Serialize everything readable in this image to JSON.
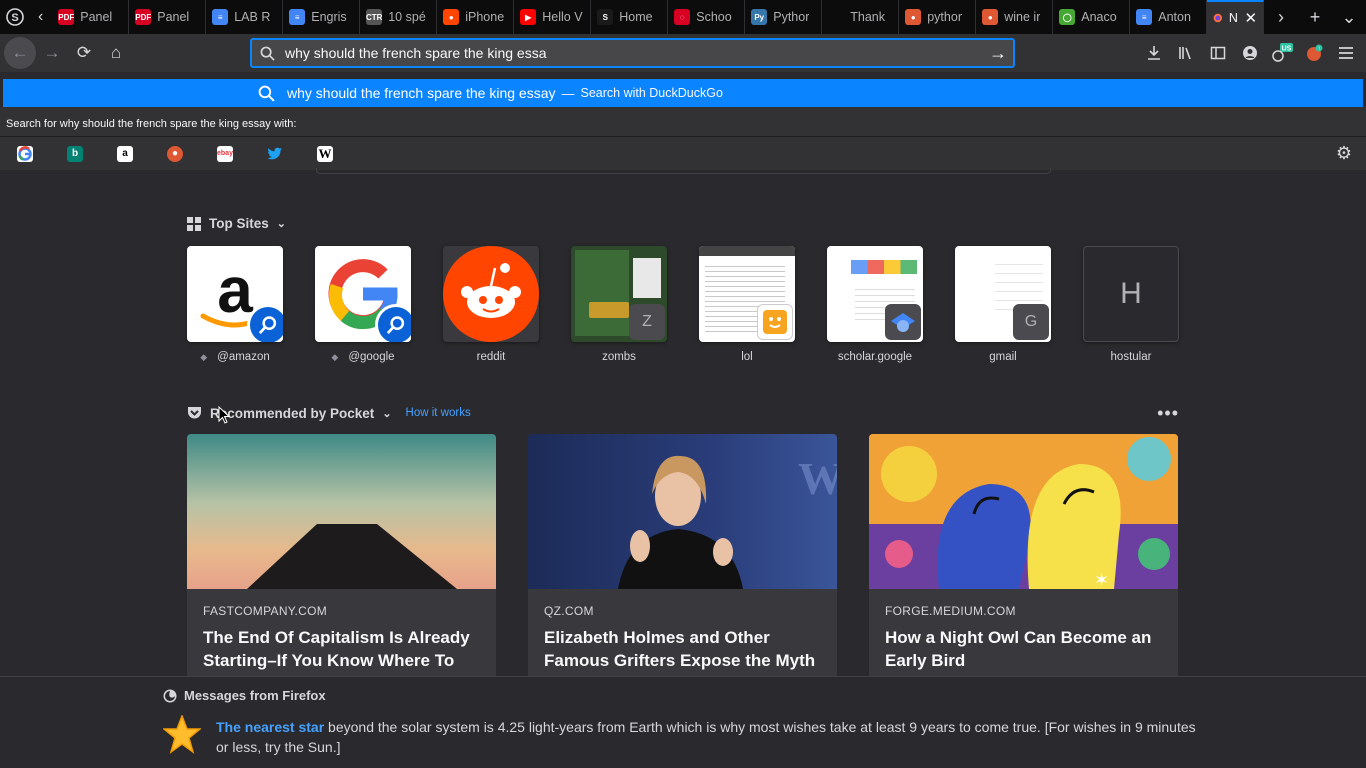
{
  "tabs": [
    {
      "label": "Panel",
      "favicon": "pdf-icon",
      "color": "#d70022"
    },
    {
      "label": "Panel",
      "favicon": "pdf-icon",
      "color": "#d70022"
    },
    {
      "label": "LAB R",
      "favicon": "docs-icon",
      "color": "#4285f4"
    },
    {
      "label": "Engris",
      "favicon": "docs-icon",
      "color": "#4285f4"
    },
    {
      "label": "10 spé",
      "favicon": "site-icon",
      "color": "#555"
    },
    {
      "label": "iPhone",
      "favicon": "reddit-icon",
      "color": "#ff4500"
    },
    {
      "label": "Hello V",
      "favicon": "youtube-icon",
      "color": "#ff0000"
    },
    {
      "label": "Home",
      "favicon": "schoology-icon",
      "color": "#1a1a1a"
    },
    {
      "label": "Schoo",
      "favicon": "loading-icon",
      "color": "#d70022"
    },
    {
      "label": "Pythor",
      "favicon": "python-icon",
      "color": "#3776ab"
    },
    {
      "label": "Thank",
      "favicon": "blank-icon",
      "color": "#0c0c0d"
    },
    {
      "label": "pythor",
      "favicon": "duckduckgo-icon",
      "color": "#de5833"
    },
    {
      "label": "wine ir",
      "favicon": "duckduckgo-icon",
      "color": "#de5833"
    },
    {
      "label": "Anaco",
      "favicon": "anaconda-icon",
      "color": "#44a833"
    },
    {
      "label": "Anton",
      "favicon": "docs-icon",
      "color": "#4285f4"
    }
  ],
  "active_tab": {
    "label": "Ne",
    "favicon": "firefox-icon"
  },
  "urlbar": {
    "value": "why should the french spare the king essa"
  },
  "suggestion": {
    "query": "why should the french spare the king essay",
    "dash": "—",
    "engine": "Search with DuckDuckGo"
  },
  "oneoff": {
    "label": "Search for why should the french spare the king essay with:"
  },
  "top_sites": {
    "title": "Top Sites",
    "items": [
      {
        "label": "@amazon"
      },
      {
        "label": "@google"
      },
      {
        "label": "reddit"
      },
      {
        "label": "zombs",
        "badge": "Z"
      },
      {
        "label": "lol"
      },
      {
        "label": "scholar.google"
      },
      {
        "label": "gmail",
        "badge": "G"
      },
      {
        "label": "hostular",
        "letter": "H"
      }
    ]
  },
  "pocket": {
    "title": "Recommended by Pocket",
    "how_link": "How it works",
    "more": "•••",
    "cards": [
      {
        "source": "FASTCOMPANY.COM",
        "title": "The End Of Capitalism Is Already Starting–If You Know Where To Look"
      },
      {
        "source": "QZ.COM",
        "title": "Elizabeth Holmes and Other Famous Grifters Expose the Myth of Quick and Easy Success"
      },
      {
        "source": "FORGE.MEDIUM.COM",
        "title": "How a Night Owl Can Become an Early Bird"
      }
    ]
  },
  "messages": {
    "title": "Messages from Firefox",
    "link": "The nearest star",
    "body": " beyond the solar system is 4.25 light-years from Earth which is why most wishes take at least 9 years to come true. [For wishes in 9 minutes or less, try the Sun.]"
  },
  "colors": {
    "accent": "#0a84ff",
    "link": "#45a1ff",
    "background": "#2a2a2e"
  }
}
